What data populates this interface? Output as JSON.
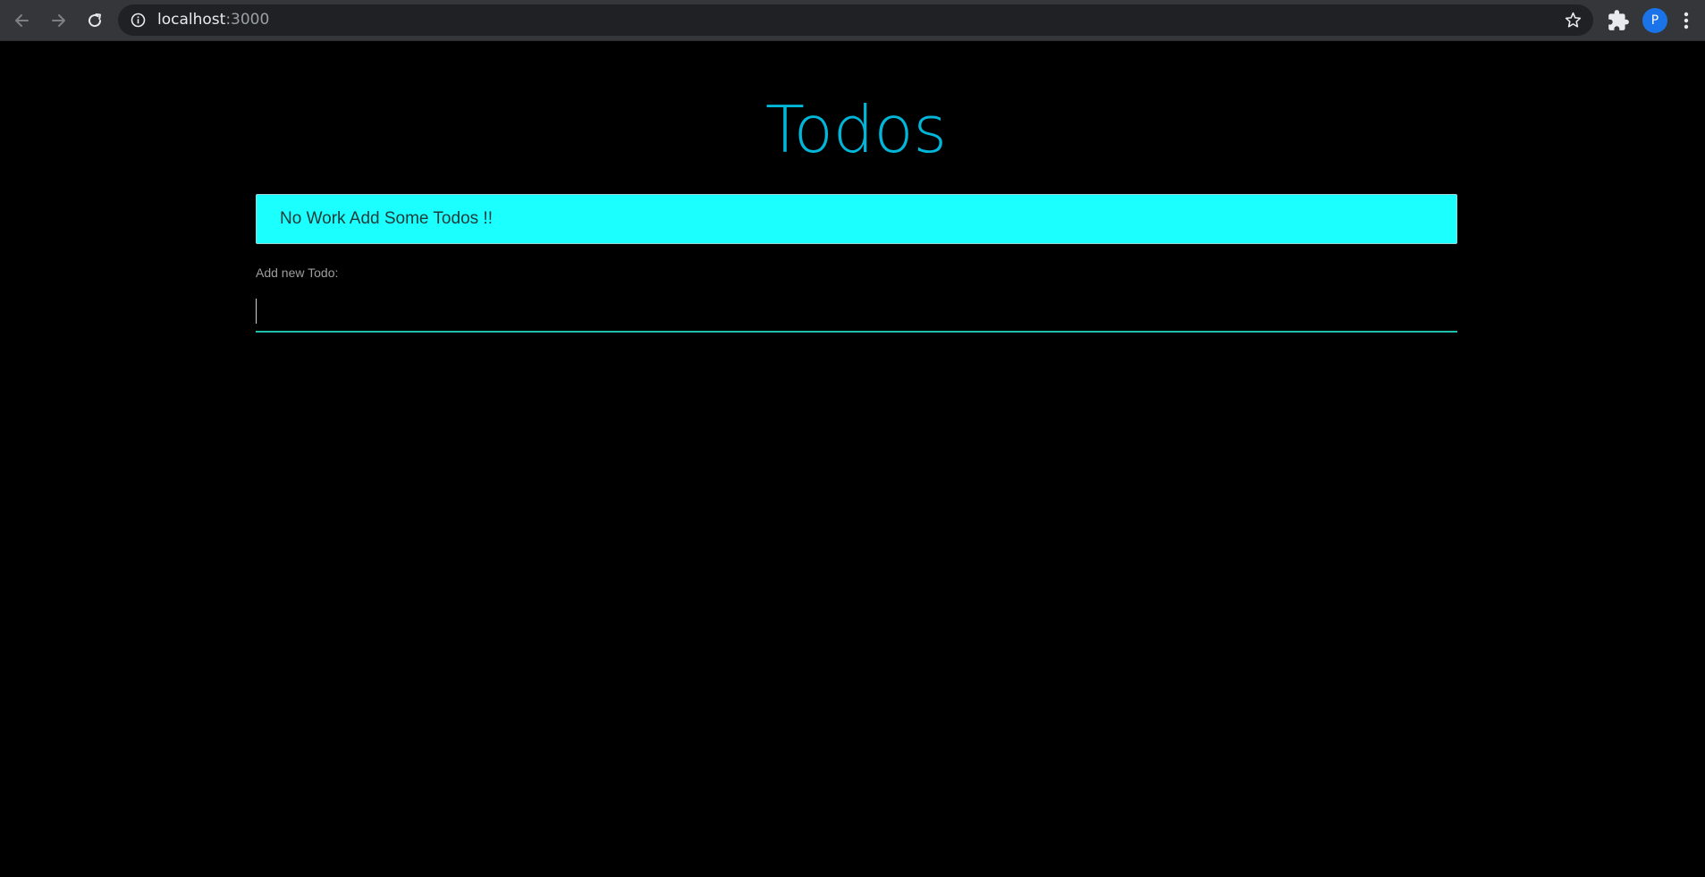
{
  "browser": {
    "url_host": "localhost",
    "url_port": ":3000",
    "profile_initial": "P",
    "accent_color": "#1a73e8"
  },
  "icons": {
    "back": "arrow-left-icon",
    "forward": "arrow-right-icon",
    "reload": "reload-icon",
    "site_info": "info-icon",
    "bookmark": "star-icon",
    "extensions": "puzzle-icon",
    "menu": "kebab-menu-icon"
  },
  "page": {
    "title": "Todos",
    "title_color": "#00b7d9",
    "alert_text": "No Work Add Some Todos !!",
    "alert_color": "#1bffff",
    "input_label": "Add new Todo:",
    "input_value": "",
    "input_underline_color": "#1fbfae"
  }
}
